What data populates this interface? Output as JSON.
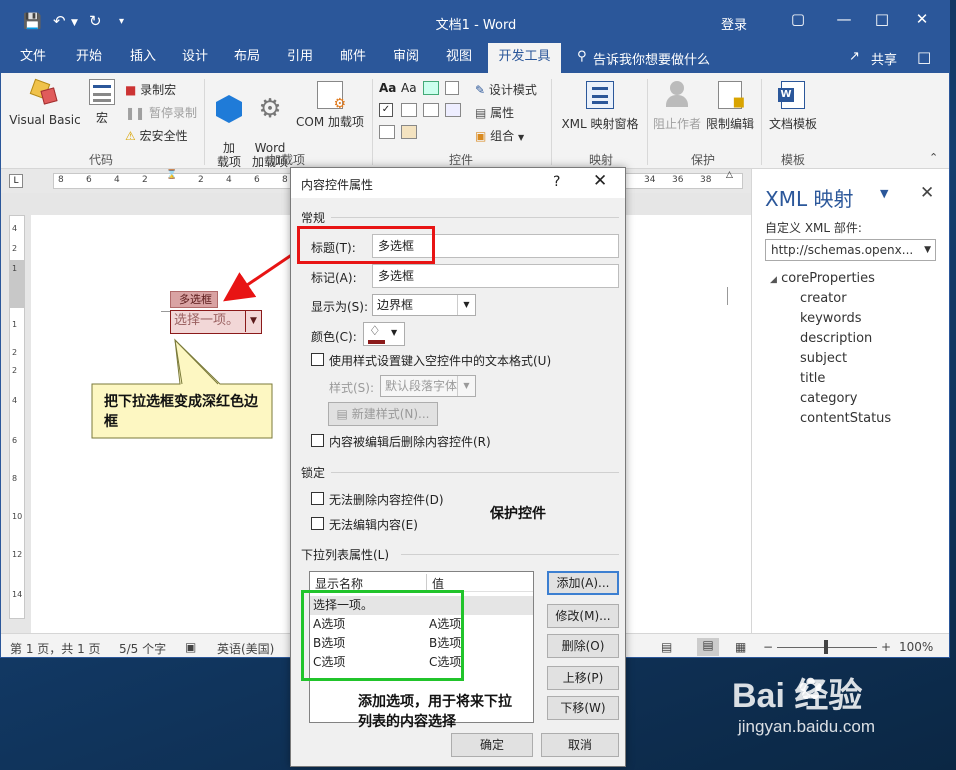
{
  "window": {
    "title": "文档1  -  Word",
    "login": "登录"
  },
  "menu": {
    "tabs": [
      "文件",
      "开始",
      "插入",
      "设计",
      "布局",
      "引用",
      "邮件",
      "审阅",
      "视图",
      "开发工具"
    ],
    "tell_me": "告诉我你想要做什么",
    "share": "共享"
  },
  "ribbon": {
    "code_group": {
      "label": "代码",
      "visual_basic": "Visual Basic",
      "macro": "宏",
      "record": "录制宏",
      "pause": "暂停录制",
      "security": "宏安全性"
    },
    "addins_group": {
      "label": "加载项",
      "addins": "加\n载项",
      "word_addins": "Word\n加载项",
      "com_addins": "COM 加载项"
    },
    "controls_group": {
      "label": "控件",
      "design_mode": "设计模式",
      "properties": "属性",
      "group": "组合"
    },
    "mapping_group": {
      "label": "映射",
      "xml_pane": "XML 映射窗格"
    },
    "protect_group": {
      "label": "保护",
      "block_authors": "阻止作者",
      "restrict_editing": "限制编辑"
    },
    "templates_group": {
      "label": "模板",
      "document_template": "文档模板"
    }
  },
  "ruler": {
    "ticks": [
      "8",
      "6",
      "4",
      "2",
      "2",
      "4",
      "6",
      "8",
      "34",
      "36",
      "38"
    ],
    "vticks": [
      "4",
      "2",
      "1",
      "2",
      "1",
      "2",
      "4",
      "6",
      "8",
      "10",
      "12",
      "14"
    ]
  },
  "document": {
    "cc_tag": "多选框",
    "cc_placeholder": "选择一项。"
  },
  "status": {
    "page": "第 1 页，共 1 页",
    "words": "5/5 个字",
    "language": "英语(美国)",
    "zoom": "100%"
  },
  "xml_pane": {
    "title": "XML 映射",
    "part_label": "自定义 XML 部件:",
    "part_value": "http://schemas.openx...",
    "root": "coreProperties",
    "nodes": [
      "creator",
      "keywords",
      "description",
      "subject",
      "title",
      "category",
      "contentStatus"
    ]
  },
  "dialog": {
    "title": "内容控件属性",
    "help": "?",
    "general": "常规",
    "title_label": "标题(T):",
    "title_value": "多选框",
    "tag_label": "标记(A):",
    "tag_value": "多选框",
    "show_as_label": "显示为(S):",
    "show_as_value": "边界框",
    "color_label": "颜色(C):",
    "use_style": "使用样式设置键入空控件中的文本格式(U)",
    "style_label": "样式(S):",
    "style_value": "默认段落字体",
    "new_style": "新建样式(N)...",
    "remove_after_edit": "内容被编辑后删除内容控件(R)",
    "locking": "锁定",
    "cannot_delete": "无法删除内容控件(D)",
    "cannot_edit": "无法编辑内容(E)",
    "dropdown_props": "下拉列表属性(L)",
    "col_display": "显示名称",
    "col_value": "值",
    "items": [
      {
        "display": "选择一项。",
        "value": ""
      },
      {
        "display": "A选项",
        "value": "A选项"
      },
      {
        "display": "B选项",
        "value": "B选项"
      },
      {
        "display": "C选项",
        "value": "C选项"
      }
    ],
    "add": "添加(A)...",
    "modify": "修改(M)...",
    "delete": "删除(O)",
    "move_up": "上移(P)",
    "move_down": "下移(W)",
    "ok": "确定",
    "cancel": "取消"
  },
  "annotations": {
    "callout1": "把下拉选框变成深红色边框",
    "callout2": "保护控件",
    "callout3": "添加选项，用于将来下拉列表的内容选择"
  },
  "watermark": {
    "brand": "Bai  经验",
    "url": "jingyan.baidu.com"
  },
  "colors": {
    "word_blue": "#2b579a",
    "cc_border": "#8b1a1a",
    "annotation_red": "#e81414",
    "annotation_green": "#21c42b",
    "callout_fill": "#fdf7c2"
  }
}
